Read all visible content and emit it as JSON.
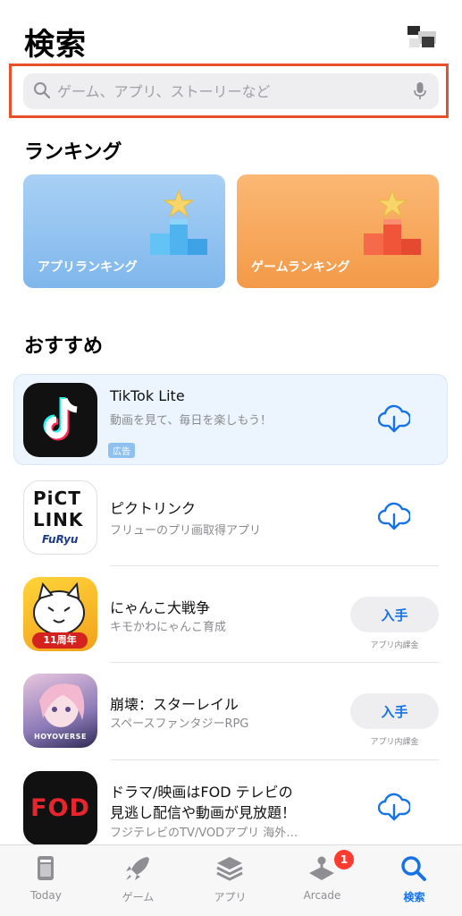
{
  "header": {
    "title": "検索"
  },
  "search": {
    "placeholder": "ゲーム、アプリ、ストーリーなど"
  },
  "ranking": {
    "title": "ランキング",
    "cards": [
      {
        "label": "アプリランキング",
        "color": "#7fb7ec"
      },
      {
        "label": "ゲームランキング",
        "color": "#f39a48"
      }
    ]
  },
  "recommended": {
    "title": "おすすめ",
    "apps": [
      {
        "name": "TikTok Lite",
        "subtitle": "動画を見て、毎日を楽しもう！",
        "badge": "広告",
        "action": "download-icon"
      },
      {
        "name": "ピクトリンク",
        "subtitle": "フリューのプリ画取得アプリ",
        "action": "download-icon",
        "icon_text": [
          "PiCT",
          "LINK",
          "FuRyu"
        ]
      },
      {
        "name": "にゃんこ大戦争",
        "subtitle": "キモかわにゃんこ育成",
        "action_label": "入手",
        "iap_note": "アプリ内課金",
        "icon_text": "11周年"
      },
      {
        "name": "崩壊：スターレイル",
        "subtitle": "スペースファンタジーRPG",
        "action_label": "入手",
        "iap_note": "アプリ内課金",
        "icon_text": "HOYOVERSE"
      },
      {
        "name_line1": "ドラマ/映画はFOD テレビの",
        "name_line2": "見逃し配信や動画が見放題！",
        "subtitle": "フジテレビのTV/VODアプリ 海外…",
        "action": "download-icon",
        "icon_text": "FOD"
      }
    ]
  },
  "tabbar": {
    "tabs": [
      {
        "label": "Today",
        "icon": "today-icon"
      },
      {
        "label": "ゲーム",
        "icon": "rocket-icon"
      },
      {
        "label": "アプリ",
        "icon": "layers-icon"
      },
      {
        "label": "Arcade",
        "icon": "joystick-icon",
        "badge": "1"
      },
      {
        "label": "検索",
        "icon": "search-icon",
        "active": true
      }
    ]
  },
  "colors": {
    "accent": "#1573e6",
    "highlight": "#e8502a",
    "badge": "#ff3b30"
  }
}
